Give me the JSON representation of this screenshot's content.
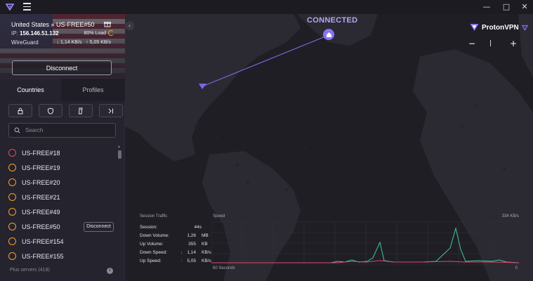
{
  "titlebar": {
    "menu_icon": "hamburger-icon",
    "controls": [
      "minimize-icon",
      "maximize-icon",
      "close-icon"
    ]
  },
  "connection": {
    "server": "United States » US-FREE#50",
    "ip_label": "IP:",
    "ip": "156.146.51.132",
    "load": "80% Load",
    "protocol": "WireGuard",
    "down_speed": "1,14 KB/s",
    "up_speed": "5,05 KB/s",
    "disconnect_label": "Disconnect"
  },
  "tabs": [
    {
      "label": "Countries",
      "active": true
    },
    {
      "label": "Profiles",
      "active": false
    }
  ],
  "feature_filters": [
    "lock-icon",
    "shield-icon",
    "p2p-icon",
    "tor-icon"
  ],
  "search": {
    "placeholder": "Search"
  },
  "servers": [
    {
      "name": "US-FREE#18",
      "status": "red"
    },
    {
      "name": "US-FREE#19",
      "status": "orange"
    },
    {
      "name": "US-FREE#20",
      "status": "orange"
    },
    {
      "name": "US-FREE#21",
      "status": "orange"
    },
    {
      "name": "US-FREE#49",
      "status": "orange"
    },
    {
      "name": "US-FREE#50",
      "status": "orange",
      "connected": true,
      "button": "Disconnect"
    },
    {
      "name": "US-FREE#154",
      "status": "orange"
    },
    {
      "name": "US-FREE#155",
      "status": "orange"
    }
  ],
  "footer": {
    "text": "Plus servers (418)",
    "info_icon": "i"
  },
  "map": {
    "status": "CONNECTED",
    "brand": "ProtonVPN",
    "zoom_out": "−",
    "zoom_level": "|",
    "zoom_in": "+"
  },
  "stats": {
    "title": "Session Traffic",
    "rows": [
      {
        "label": "Session:",
        "value": "44s",
        "unit": ""
      },
      {
        "label": "Down Volume:",
        "value": "1,26",
        "unit": "MB"
      },
      {
        "label": "Up Volume:",
        "value": "355",
        "unit": "KB"
      },
      {
        "label": "Down Speed:",
        "value": "1,14",
        "unit": "KB/s",
        "arrow": "↓"
      },
      {
        "label": "Up Speed:",
        "value": "5,05",
        "unit": "KB/s",
        "arrow": "↑"
      }
    ],
    "graph_title": "Speed",
    "graph_max": "334 KB/s",
    "graph_time": "60 Seconds",
    "graph_end": "0"
  },
  "colors": {
    "accent": "#8b74f0",
    "load_ring": "#f6a12b",
    "down_line": "#3fc89a",
    "up_line": "#e0476a"
  }
}
